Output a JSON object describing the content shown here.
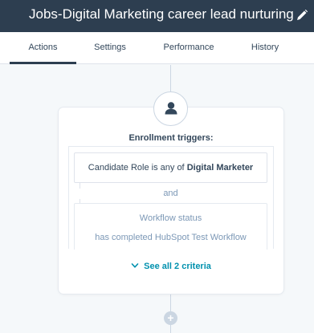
{
  "header": {
    "title": "Jobs-Digital Marketing career lead nurturing",
    "edit_icon": "pencil-icon"
  },
  "tabs": [
    {
      "label": "Actions",
      "active": true
    },
    {
      "label": "Settings",
      "active": false
    },
    {
      "label": "Performance",
      "active": false
    },
    {
      "label": "History",
      "active": false
    }
  ],
  "trigger_card": {
    "icon": "contact-avatar-icon",
    "title": "Enrollment triggers:",
    "criteria_1": {
      "prefix": "Candidate Role is any of ",
      "value": "Digital Marketer"
    },
    "joiner": "and",
    "criteria_2": {
      "line1": "Workflow status",
      "line2": "has completed HubSpot Test Workflow"
    },
    "see_all": "See all 2 criteria"
  },
  "add_action": {
    "label": "+",
    "icon": "plus-icon"
  },
  "colors": {
    "header_bg": "#2d3e50",
    "link": "#0091ae",
    "canvas_bg": "#f5f8fa",
    "text": "#33475b",
    "muted": "#7c98b6"
  }
}
